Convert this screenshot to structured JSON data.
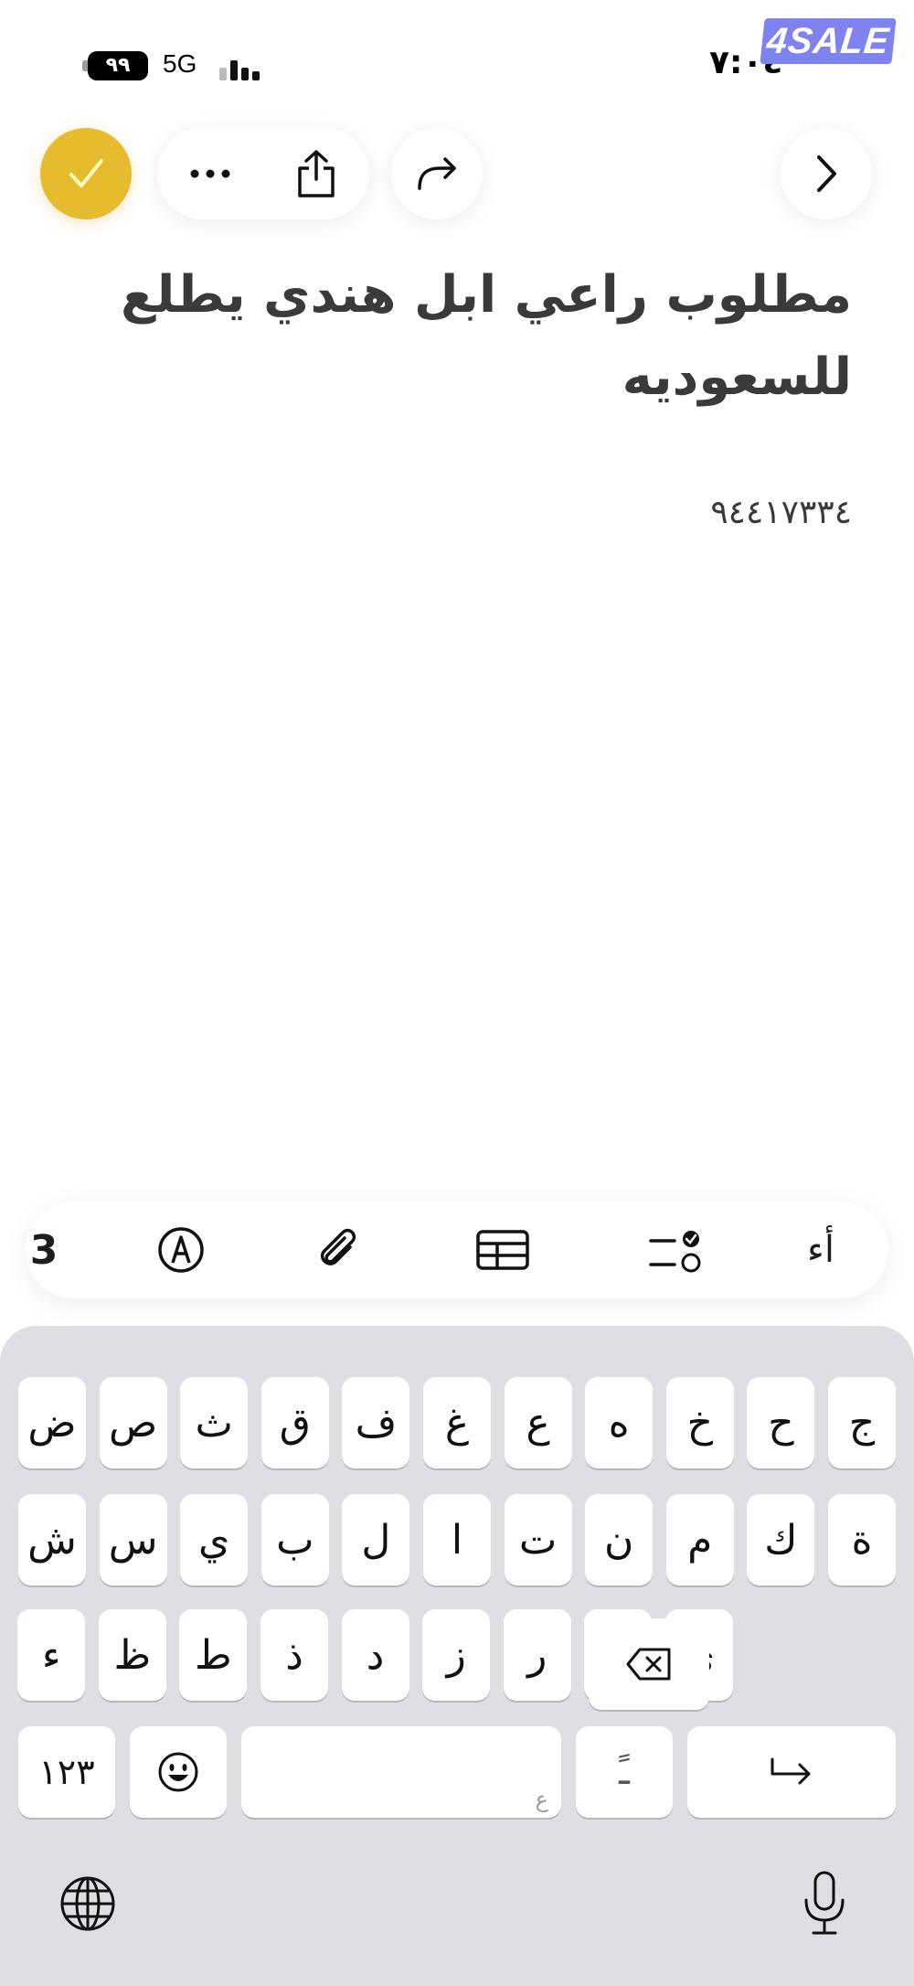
{
  "status_bar": {
    "battery": "٩٩",
    "network": "5G",
    "time": "٧:٠٤",
    "brand_logo": "4SALE"
  },
  "toolbar": {
    "done_icon": "checkmark-icon",
    "more_icon": "ellipsis-icon",
    "share_icon": "share-icon",
    "redo_icon": "redo-icon",
    "forward_icon": "chevron-right-icon",
    "accent_color": "#e6bc2e"
  },
  "note": {
    "title_line1": "مطلوب راعي ابل  هندي يطلع",
    "title_line2": "للسعوديه",
    "body": "٩٤٤١٧٣٣٤"
  },
  "format_bar": {
    "text_style_label": "أء",
    "checklist_icon": "checklist-icon",
    "table_icon": "table-icon",
    "attach_icon": "paperclip-icon",
    "markup_icon": "pen-circle-icon",
    "more_tool_label": "3"
  },
  "keyboard": {
    "row1": [
      "ج",
      "ح",
      "خ",
      "ه",
      "ع",
      "غ",
      "ف",
      "ق",
      "ث",
      "ص",
      "ض"
    ],
    "row2": [
      "ة",
      "ك",
      "م",
      "ن",
      "ت",
      "ا",
      "ل",
      "ب",
      "ي",
      "س",
      "ش"
    ],
    "row3": [
      "ى",
      "و",
      "ر",
      "ز",
      "د",
      "ذ",
      "ط",
      "ظ",
      "ء"
    ],
    "numbers_key": "١٢٣",
    "space_hint": "ع",
    "diacritic_key": "ـً",
    "delete_icon": "delete-icon",
    "emoji_icon": "emoji-icon",
    "return_icon": "return-arrow-icon",
    "globe_icon": "globe-icon",
    "mic_icon": "microphone-icon"
  }
}
